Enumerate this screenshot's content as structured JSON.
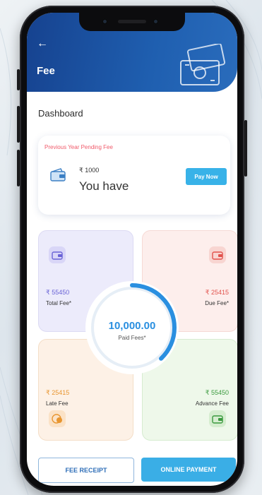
{
  "header": {
    "back_icon": "arrow-left-icon",
    "title": "Fee",
    "illustration_icon": "money-notes-icon",
    "brand_color": "#1f5fb0"
  },
  "dashboard": {
    "title": "Dashboard"
  },
  "pending_card": {
    "label": "Previous Year Pending Fee",
    "amount": "₹ 1000",
    "text": "You have",
    "pay_button": "Pay Now",
    "label_color": "#f05a6a"
  },
  "tiles": {
    "total": {
      "amount": "₹ 55450",
      "label": "Total Fee*",
      "icon": "wallet-icon",
      "color": "#6a63d6"
    },
    "due": {
      "amount": "₹ 25415",
      "label": "Due Fee*",
      "icon": "wallet-icon",
      "color": "#e2524c"
    },
    "late": {
      "amount": "₹ 25415",
      "label": "Late Fee",
      "icon": "coins-icon",
      "color": "#e8952f"
    },
    "advance": {
      "amount": "₹ 55450",
      "label": "Advance Fee",
      "icon": "wallet-icon",
      "color": "#3a9a3e"
    }
  },
  "paid": {
    "value": "10,000.00",
    "label": "Paid Fees*",
    "progress": 0.38,
    "ring_color": "#2a8fe0"
  },
  "actions": {
    "receipt_label": "FEE RECEIPT",
    "online_label": "ONLINE PAYMENT"
  }
}
